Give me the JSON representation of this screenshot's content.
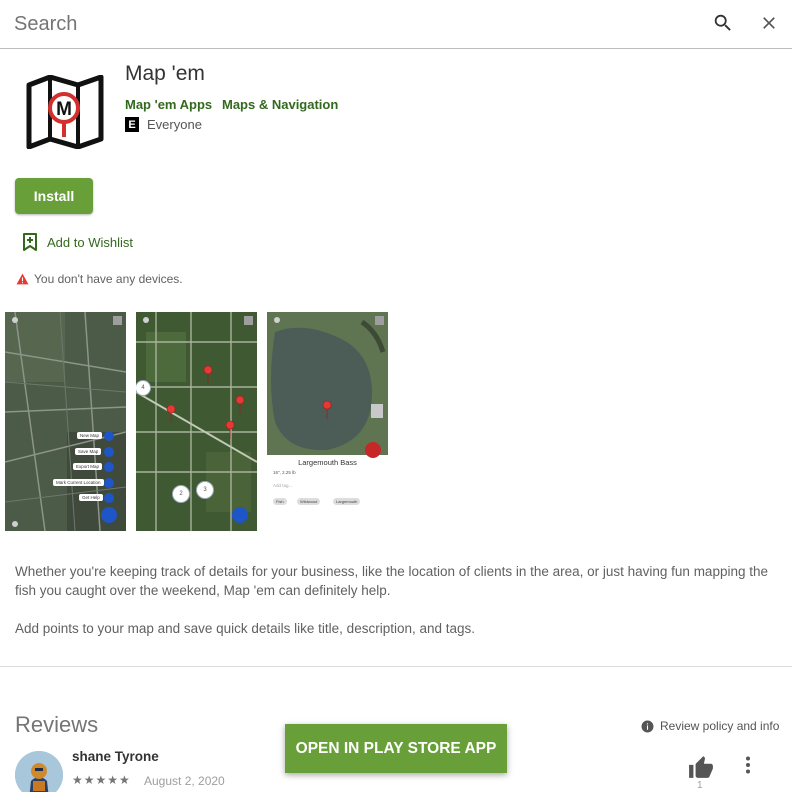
{
  "search": {
    "placeholder": "Search"
  },
  "app": {
    "title": "Map 'em",
    "developer": "Map 'em Apps",
    "category": "Maps & Navigation",
    "content_rating_badge": "E",
    "content_rating": "Everyone",
    "icon": "map-m-logo-icon"
  },
  "actions": {
    "install_label": "Install",
    "wishlist_label": "Add to Wishlist",
    "warning_text": "You don't have any devices."
  },
  "screenshots": {
    "shot1": {
      "menu": [
        "New Map",
        "Save Map",
        "Export Map",
        "Mark Current Location",
        "Get Help"
      ]
    },
    "shot2": {
      "clusters": [
        "4",
        "2",
        "3"
      ]
    },
    "shot3": {
      "card_title": "Largemouth Bass",
      "card_sub": "16\", 2.25 lb",
      "tags_placeholder": "Add tag...",
      "tags": [
        "Fish",
        "Wildwood",
        "Largemouth"
      ]
    }
  },
  "description": {
    "paragraph1": "Whether you're keeping track of details for your business, like the location of clients in the area, or just having fun mapping the fish you caught over the weekend, Map 'em can definitely help.",
    "paragraph2": "Add points to your map and save quick details like title, description, and tags."
  },
  "reviews": {
    "title": "Reviews",
    "policy_label": "Review policy and info",
    "items": [
      {
        "name": "shane Tyrone",
        "stars": "★★★★★",
        "rating": 5,
        "date": "August 2, 2020",
        "helpful_count": "1"
      }
    ]
  },
  "cta": {
    "open_store_label": "OPEN IN PLAY STORE APP"
  },
  "colors": {
    "accent": "#689f38",
    "link": "#33691e",
    "warning": "#e53935"
  }
}
